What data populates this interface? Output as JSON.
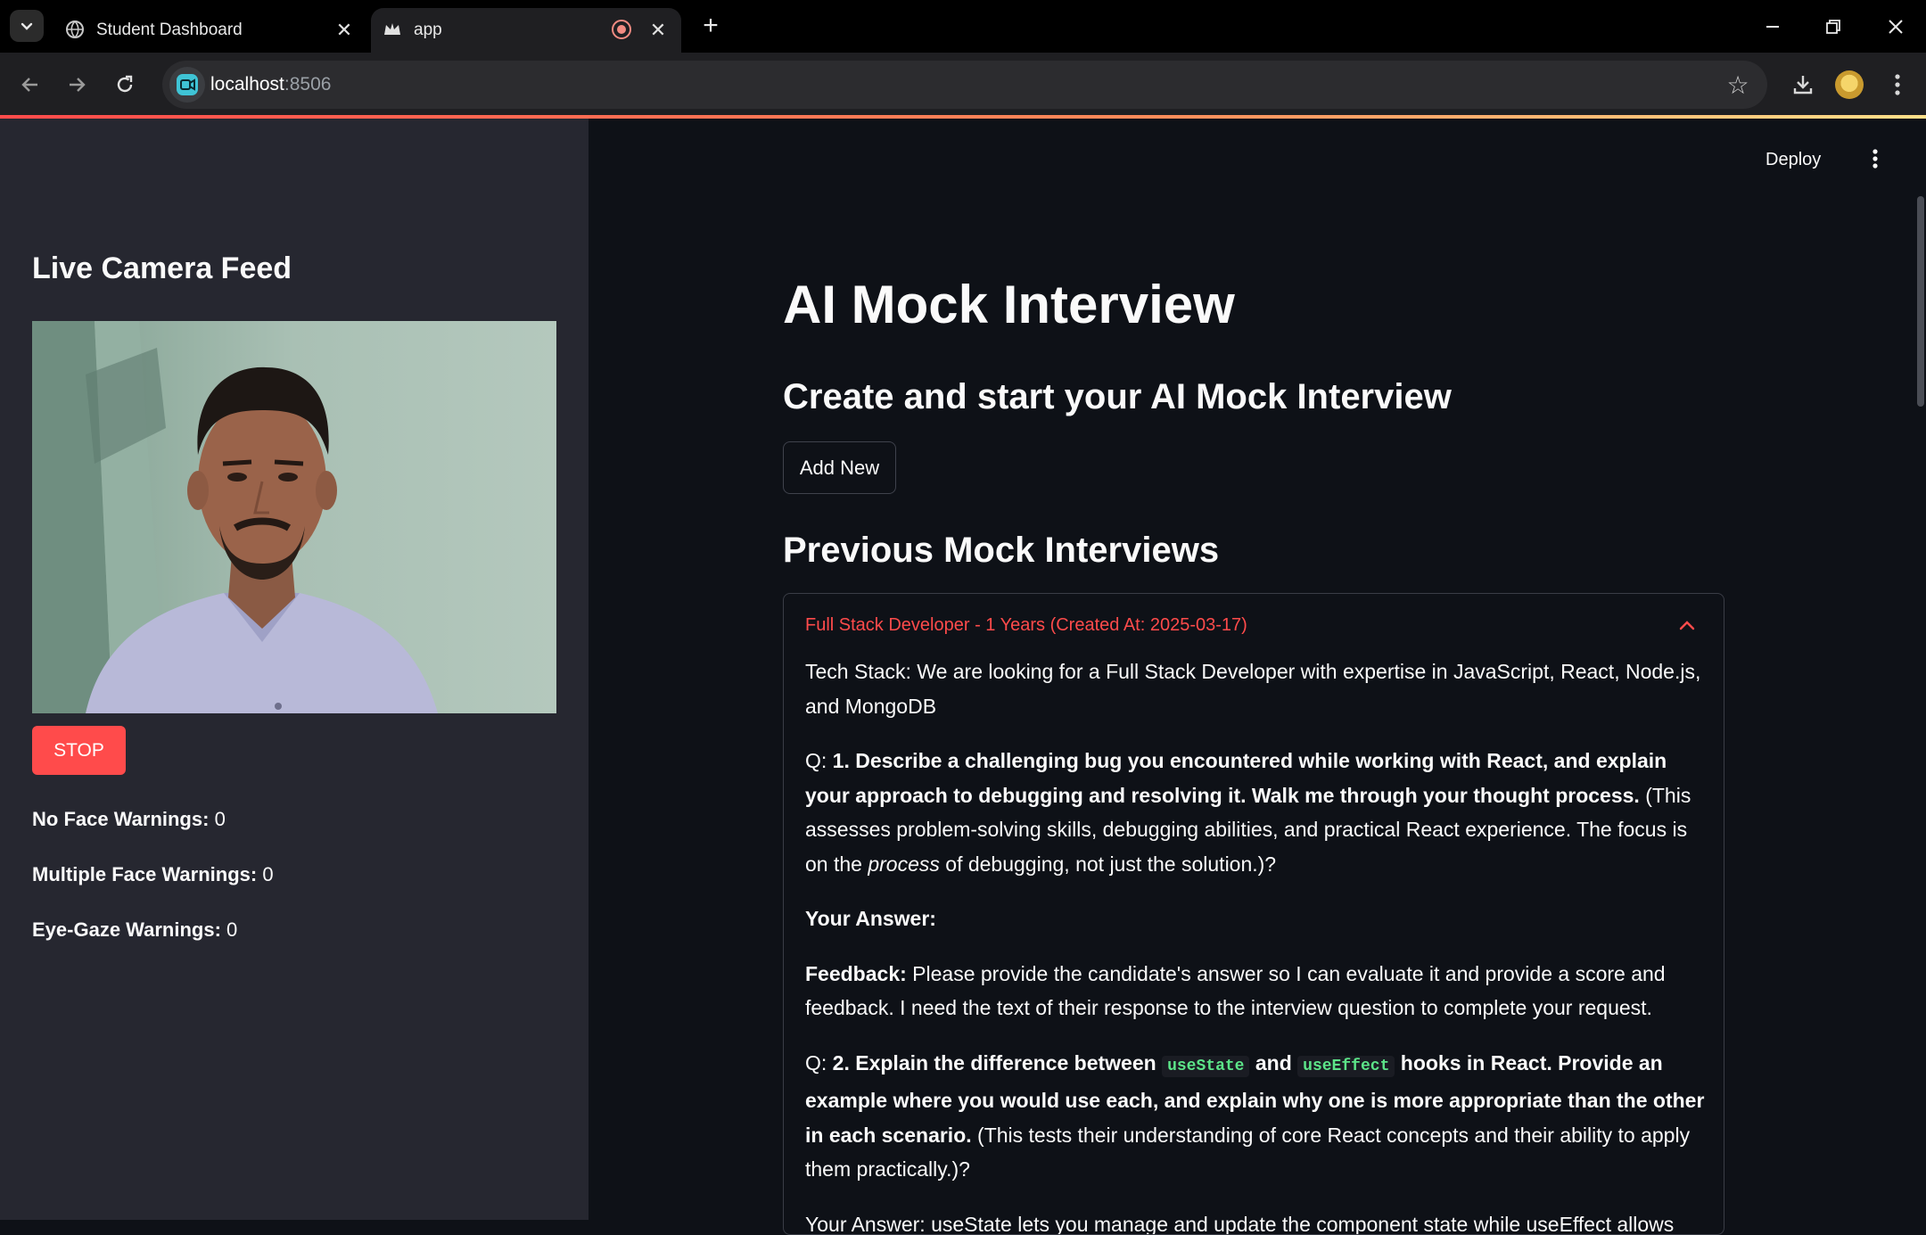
{
  "browser": {
    "tabs": [
      {
        "title": "Student Dashboard",
        "icon": "globe-icon",
        "active": false
      },
      {
        "title": "app",
        "icon": "streamlit-crown-icon",
        "active": true
      }
    ],
    "url_host": "localhost",
    "url_port": ":8506"
  },
  "colors": {
    "accent": "#ff4b4b",
    "background": "#0e1117",
    "sidebar": "#262730",
    "code": "#5ce488"
  },
  "header": {
    "deploy_label": "Deploy"
  },
  "sidebar": {
    "title": "Live Camera Feed",
    "stop_label": "STOP",
    "warnings": [
      {
        "label": "No Face Warnings:",
        "value": "0"
      },
      {
        "label": "Multiple Face Warnings:",
        "value": "0"
      },
      {
        "label": "Eye-Gaze Warnings:",
        "value": "0"
      }
    ]
  },
  "main": {
    "title": "AI Mock Interview",
    "subtitle": "Create and start your AI Mock Interview",
    "add_new_label": "Add New",
    "previous_heading": "Previous Mock Interviews",
    "interview": {
      "header": "Full Stack Developer - 1 Years (Created At: 2025-03-17)",
      "tech_stack": "Tech Stack: We are looking for a Full Stack Developer with expertise in JavaScript, React, Node.js, and MongoDB",
      "q1_prefix": "Q: ",
      "q1_bold": "1. Describe a challenging bug you encountered while working with React, and explain your approach to debugging and resolving it. Walk me through your thought process.",
      "q1_rest_a": " (This assesses problem-solving skills, debugging abilities, and practical React experience. The focus is on the ",
      "q1_italic": "process",
      "q1_rest_b": " of debugging, not just the solution.)?",
      "answer_label": "Your Answer:",
      "feedback_label": "Feedback:",
      "feedback_text": " Please provide the candidate's answer so I can evaluate it and provide a score and feedback. I need the text of their response to the interview question to complete your request.",
      "q2_prefix": "Q: ",
      "q2_bold_a": "2. Explain the difference between ",
      "q2_code_a": "useState",
      "q2_bold_b": " and ",
      "q2_code_b": "useEffect",
      "q2_bold_c": " hooks in React. Provide an example where you would use each, and explain why one is more appropriate than the other in each scenario.",
      "q2_rest": " (This tests their understanding of core React concepts and their ability to apply them practically.)?",
      "cut_line": "Your Answer: useState lets you manage and update the component state while useEffect allows"
    }
  }
}
